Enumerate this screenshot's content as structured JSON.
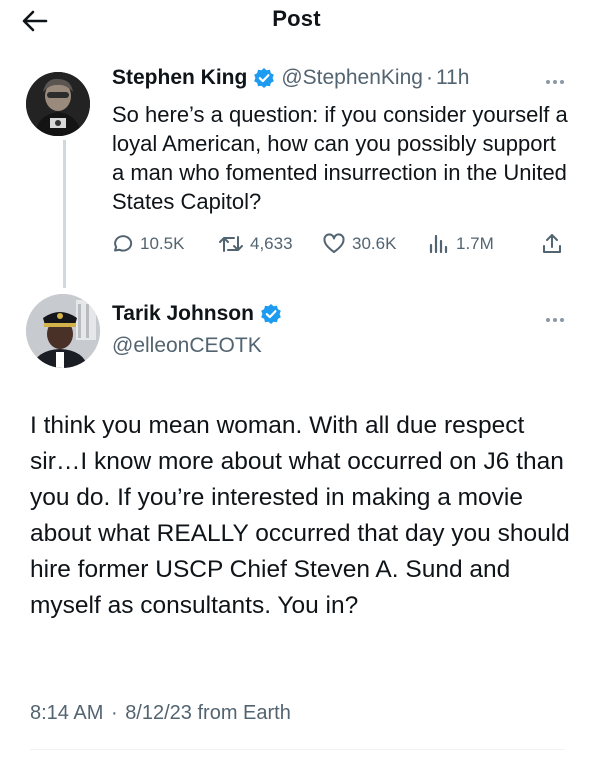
{
  "header": {
    "title": "Post",
    "back_icon": "arrow-left-icon"
  },
  "parent_post": {
    "author_name": "Stephen King",
    "verified": true,
    "handle": "@StephenKing",
    "separator": "·",
    "time": "11h",
    "text": "So here’s a question: if you consider yourself a loyal American, how can you possibly support a man who fomented insurrection in the United States Capitol?",
    "replies": "10.5K",
    "reposts": "4,633",
    "likes": "30.6K",
    "views": "1.7M",
    "icons": [
      "reply-icon",
      "repost-icon",
      "like-icon",
      "views-icon",
      "share-icon",
      "more-icon"
    ]
  },
  "reply_post": {
    "author_name": "Tarik Johnson",
    "verified": true,
    "handle": "@elleonCEOTK",
    "text": "I think you mean woman. With all due respect sir…I know more about what occurred on J6 than you do. If you’re interested in making a movie about what REALLY occurred that day you should hire former USCP Chief Steven A. Sund and myself as consultants. You in?",
    "time": "8:14 AM",
    "separator": "·",
    "date": "8/12/23",
    "source": "from Earth"
  },
  "colors": {
    "text": "#0f1419",
    "secondary": "#536471",
    "verified": "#1d9bf0",
    "line": "#cfd9de"
  }
}
